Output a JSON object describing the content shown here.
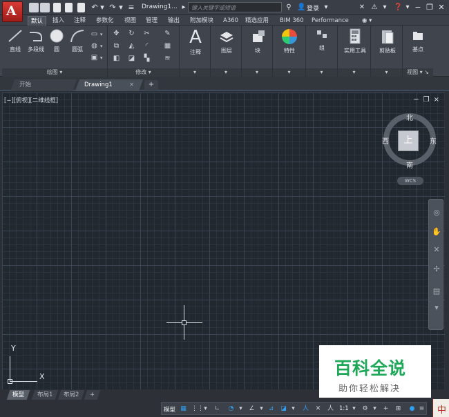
{
  "app": {
    "logo_letter": "A",
    "document_title": "Drawing1...",
    "search_placeholder": "键入关键字或短语",
    "login_label": "登录"
  },
  "ribbon_tabs": [
    "默认",
    "插入",
    "注释",
    "参数化",
    "视图",
    "管理",
    "输出",
    "附加模块",
    "A360",
    "精选应用",
    "BIM 360",
    "Performance"
  ],
  "ribbon_active_tab": "默认",
  "ribbon": {
    "draw_tools": [
      "直线",
      "多段线",
      "圆",
      "圆弧"
    ],
    "draw_panel": "绘图",
    "modify_panel": "修改",
    "annotate": "注释",
    "layers": "图层",
    "block": "块",
    "properties": "特性",
    "group": "组",
    "utilities": "实用工具",
    "clipboard": "剪贴板",
    "base": "基点",
    "view_panel": "视图"
  },
  "file_tabs": {
    "start": "开始",
    "drawing": "Drawing1",
    "close_glyph": "×",
    "add_glyph": "+"
  },
  "viewport": {
    "label": "[−][俯视][二维线框]",
    "controls": [
      "−",
      "❐",
      "×"
    ]
  },
  "viewcube": {
    "north": "北",
    "south": "南",
    "east": "东",
    "west": "西",
    "face": "上",
    "wcs": "WCS"
  },
  "ucs": {
    "x": "X",
    "y": "Y"
  },
  "layout_tabs": {
    "model": "模型",
    "layout1": "布局1",
    "layout2": "布局2",
    "add": "+"
  },
  "statusbar": {
    "model_label": "模型",
    "scale": "1:1"
  },
  "watermark": {
    "main": "百科全说",
    "sub": "助你轻松解决"
  },
  "ime": "中",
  "colors": {
    "canvas": "#212830",
    "accent": "#2f9ff0",
    "app_button": "#c8302b",
    "watermark_green": "#1da858"
  }
}
